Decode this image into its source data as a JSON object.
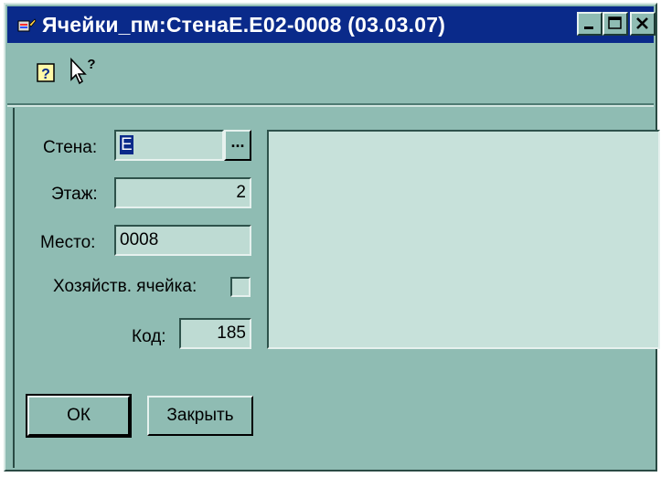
{
  "window": {
    "title": "Ячейки_пм:СтенаЕ.Е02-0008 (03.03.07)",
    "icons": [
      "app-icon",
      "minimize-icon",
      "maximize-icon",
      "close-icon"
    ]
  },
  "toolbar": {
    "icons": [
      "help-icon",
      "context-help-icon"
    ]
  },
  "form": {
    "wall_label": "Стена:",
    "wall_value": "Е",
    "wall_button": "...",
    "floor_label": "Этаж:",
    "floor_value": "2",
    "place_label": "Место:",
    "place_value": "0008",
    "household_label": "Хозяйств. ячейка:",
    "household_checked": false,
    "code_label": "Код:",
    "code_value": "185"
  },
  "buttons": {
    "ok": "ОК",
    "close": "Закрыть"
  },
  "colors": {
    "background": "#8fbcb3",
    "titlebar": "#0a2a8a",
    "field": "#bedbd3",
    "panel": "#c7e1da"
  }
}
